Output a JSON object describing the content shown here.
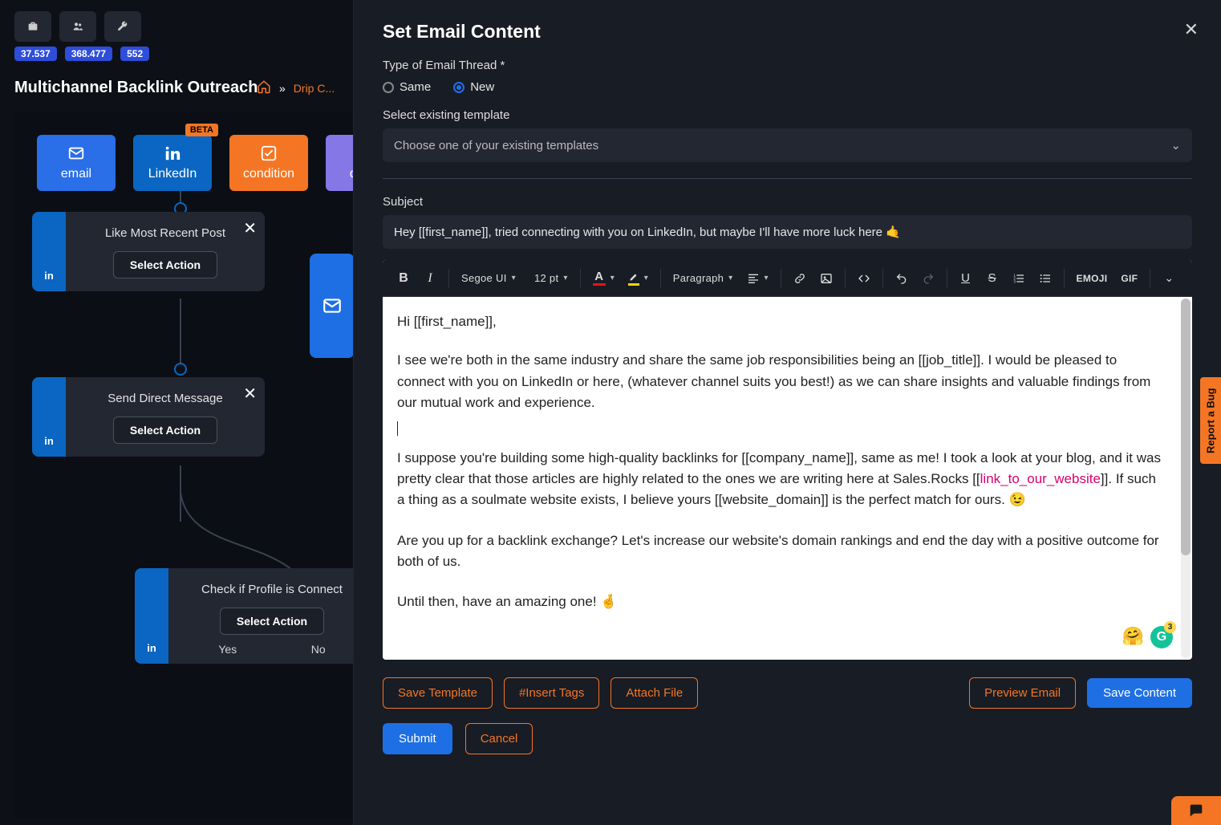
{
  "header": {
    "badges": [
      "37.537",
      "368.477",
      "552"
    ],
    "flow_title": "Multichannel Backlink Outreach",
    "breadcrumb_label": "Drip C..."
  },
  "channels": [
    {
      "key": "email",
      "label": "email"
    },
    {
      "key": "linkedin",
      "label": "LinkedIn",
      "beta": "BETA"
    },
    {
      "key": "condition",
      "label": "condition"
    },
    {
      "key": "delay",
      "label": "delay"
    }
  ],
  "nodes": {
    "like_post": {
      "title": "Like Most Recent Post",
      "action": "Select Action"
    },
    "dm": {
      "title": "Send Direct Message",
      "action": "Select Action"
    },
    "check_profile": {
      "title": "Check if Profile is Connect",
      "action": "Select Action",
      "yes": "Yes",
      "no": "No"
    }
  },
  "modal": {
    "title": "Set Email Content",
    "type_label": "Type of Email Thread *",
    "type_options": {
      "same": "Same",
      "new": "New"
    },
    "template_label": "Select existing template",
    "template_placeholder": "Choose one of your existing templates",
    "subject_label": "Subject",
    "subject_value": "Hey [[first_name]], tried connecting with you on LinkedIn, but maybe I'll have more luck here 🤙",
    "toolbar": {
      "font": "Segoe UI",
      "size": "12 pt",
      "para": "Paragraph",
      "emoji": "EMOJI",
      "gif": "GIF"
    },
    "body": {
      "p1": "Hi [[first_name]],",
      "p2a": "I see we're both in the same industry and share the same job responsibilities being an [[job_title]]. I would be pleased to connect with you on LinkedIn or here, (whatever channel suits you best!) as we can share insights and valuable findings from our mutual work and experience.",
      "p3a": "I suppose you're building some high-quality backlinks for [[company_name]], same as me! I took a look at your blog, and it was pretty clear that those articles are highly related to the ones we are writing here at Sales.Rocks [[",
      "p3link": "link_to_our_website",
      "p3b": "]]. If such a thing as a soulmate website exists, I believe yours [[website_domain]] is the perfect match for ours. 😉",
      "p4": "Are you up for a backlink exchange? Let's increase our website's domain rankings and end the day with a positive outcome for both of us.",
      "p5": "Until then, have an amazing one! 🤞"
    },
    "grammarly_badge": "3",
    "actions": {
      "save_template": "Save Template",
      "insert_tags": "#Insert Tags",
      "attach_file": "Attach File",
      "preview_email": "Preview Email",
      "save_content": "Save Content",
      "submit": "Submit",
      "cancel": "Cancel"
    }
  },
  "side": {
    "report_bug": "Report a Bug"
  }
}
